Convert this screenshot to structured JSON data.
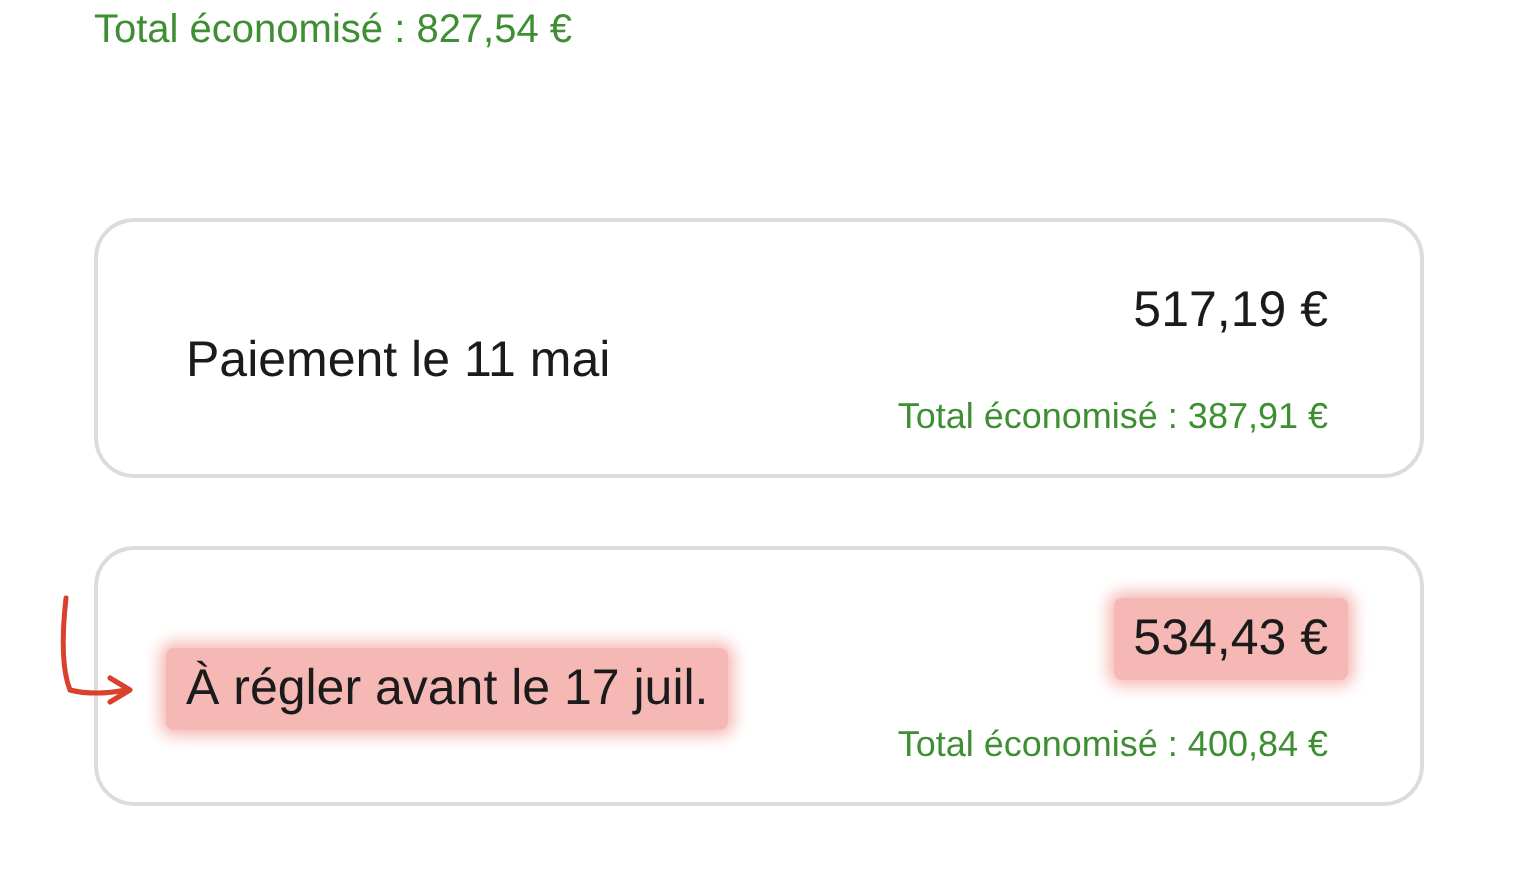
{
  "top_total": "Total économisé : 827,54 €",
  "payments": [
    {
      "label": "Paiement le 11 mai",
      "amount": "517,19 €",
      "total_saved": "Total économisé : 387,91 €",
      "highlighted": false
    },
    {
      "label": "À régler avant le 17 juil.",
      "amount": "534,43 €",
      "total_saved": "Total économisé : 400,84 €",
      "highlighted": true
    }
  ]
}
